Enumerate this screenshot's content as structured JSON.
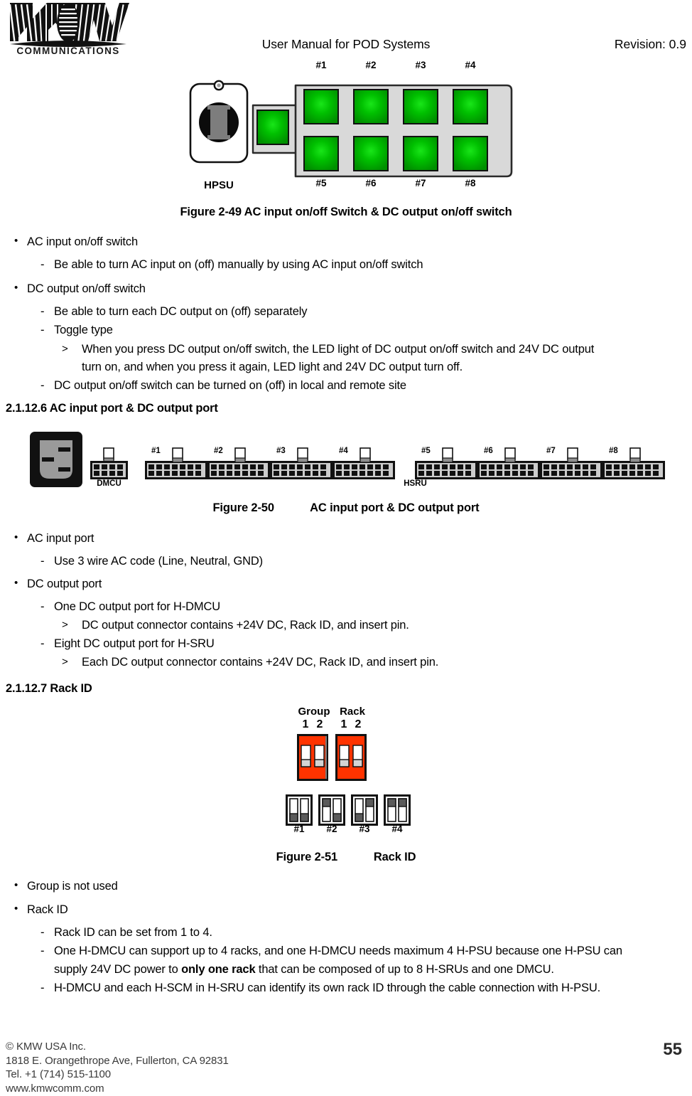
{
  "header": {
    "logo_text": "KMW",
    "logo_subtext": "COMMUNICATIONS",
    "title": "User Manual for POD Systems",
    "revision": "Revision: 0.9"
  },
  "figure_249": {
    "caption": "Figure 2-49 AC input on/off Switch & DC output on/off switch",
    "hpsu_label": "HPSU",
    "top_labels": [
      "#1",
      "#2",
      "#3",
      "#4"
    ],
    "bottom_labels": [
      "#5",
      "#6",
      "#7",
      "#8"
    ],
    "led_color": "#00b300",
    "panel_color": "#d9d9d9"
  },
  "section_ac_dc_switch": {
    "b1": "AC input on/off switch",
    "b1_d1": "Be able to turn AC input on (off) manually by using AC input on/off switch",
    "b2": "DC output on/off switch",
    "b2_d1": "Be able to turn each DC output on (off) separately",
    "b2_d2": "Toggle type",
    "b2_d2_a1": "When you press DC output on/off switch, the LED light of DC output on/off switch and 24V DC output",
    "b2_d2_a1_cont": "turn on, and when you press it again, LED light and 24V DC output turn off.",
    "b2_d3": "DC output on/off switch can be turned on (off) in local and remote site"
  },
  "section_2_1_12_6": {
    "heading": "2.1.12.6 AC input port & DC output port"
  },
  "figure_250": {
    "caption_num": "Figure 2-50",
    "caption_text": "AC input port & DC output port",
    "dmcu_label": "DMCU",
    "hsru_label": "HSRU",
    "port_labels": [
      "#1",
      "#2",
      "#3",
      "#4",
      "#5",
      "#6",
      "#7",
      "#8"
    ]
  },
  "section_ports": {
    "b1": "AC input port",
    "b1_d1": "Use 3 wire AC code (Line, Neutral, GND)",
    "b2": "DC output port",
    "b2_d1": "One DC output port for H-DMCU",
    "b2_d1_a1": "DC output connector contains +24V DC, Rack ID, and insert pin.",
    "b2_d2": "Eight DC output port for H-SRU",
    "b2_d2_a1": "Each DC output connector contains +24V DC, Rack ID, and insert pin."
  },
  "section_2_1_12_7": {
    "heading": "2.1.12.7 Rack ID"
  },
  "figure_251": {
    "caption_num": "Figure 2-51",
    "caption_text": "Rack ID",
    "group_label": "Group",
    "rack_label": "Rack",
    "group_pins": [
      "1",
      "2"
    ],
    "rack_pins": [
      "1",
      "2"
    ],
    "switch_color": "#ff3300",
    "rack_ids": [
      "#1",
      "#2",
      "#3",
      "#4"
    ],
    "rack_id_settings": [
      {
        "id": "#1",
        "sw1": "down",
        "sw2": "down"
      },
      {
        "id": "#2",
        "sw1": "up",
        "sw2": "down"
      },
      {
        "id": "#3",
        "sw1": "down",
        "sw2": "up"
      },
      {
        "id": "#4",
        "sw1": "up",
        "sw2": "up"
      }
    ]
  },
  "section_rackid": {
    "b1": "Group is not used",
    "b2": "Rack ID",
    "b2_d1": "Rack ID can be set from 1 to 4.",
    "b2_d2_part1": "One H-DMCU can support up to 4 racks, and one H-DMCU needs maximum 4 H-PSU because one H-PSU can",
    "b2_d2_part2_a": "supply 24V DC power to ",
    "b2_d2_part2_b": "only one rack",
    "b2_d2_part2_c": " that can be composed of up to 8 H-SRUs and one DMCU.",
    "b2_d3": "H-DMCU and each H-SCM in H-SRU can identify its own rack ID through the cable connection with H-PSU."
  },
  "footer": {
    "line1": "© KMW USA Inc.",
    "line2": "1818 E. Orangethrope Ave, Fullerton, CA 92831",
    "line3": "Tel. +1 (714) 515-1100",
    "line4": "www.kmwcomm.com",
    "page_number": "55"
  }
}
